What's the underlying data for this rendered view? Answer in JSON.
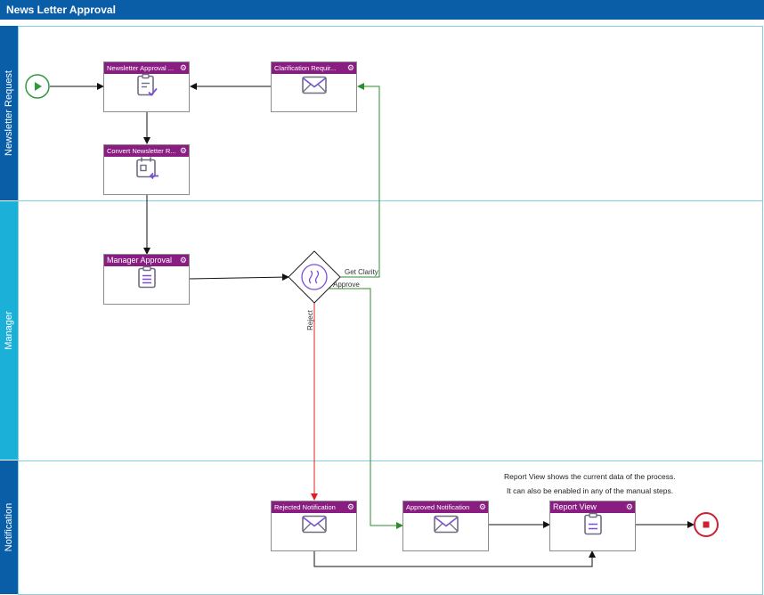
{
  "title": "News Letter Approval",
  "lanes": {
    "newsletter": "Newsletter Request",
    "manager": "Manager",
    "notification": "Notification"
  },
  "tasks": {
    "newsletter_approval": "Newsletter Approval ...",
    "clarification": "Clarification Requir...",
    "convert": "Convert Newsletter R...",
    "manager_approval": "Manager Approval",
    "rejected": "Rejected Notification",
    "approved": "Approved Notification",
    "report_view": "Report View"
  },
  "edges": {
    "get_clarity": "Get Clarity",
    "approve": "Approve",
    "reject": "Reject"
  },
  "note": {
    "line1": "Report View shows the current data of the process.",
    "line2": "It can also be enabled in any of the manual steps."
  },
  "colors": {
    "title_bar": "#0a5ea8",
    "manager_lane": "#1bb0d8",
    "task_header": "#8a1d82",
    "approve_flow": "#2e8b2e",
    "reject_flow": "#e02020",
    "start": "#2e9a3e",
    "end": "#cc2233",
    "icon": "#6e6e80",
    "icon_accent": "#7b4fd6"
  }
}
